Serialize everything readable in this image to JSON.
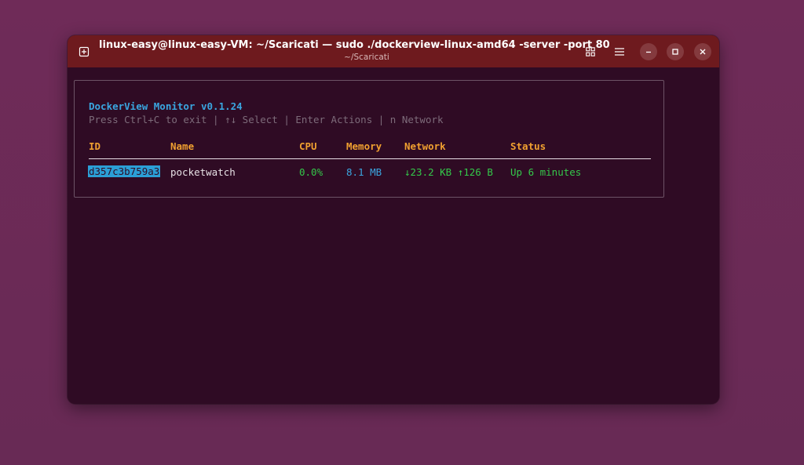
{
  "window": {
    "title": "linux-easy@linux-easy-VM: ~/Scaricati — sudo ./dockerview-linux-amd64 -server -port 80...",
    "subtitle": "~/Scaricati",
    "icons": {
      "new_tab": "new-tab-icon",
      "grid": "grid-icon",
      "menu": "hamburger-menu-icon",
      "minimize": "minimize-icon",
      "maximize": "maximize-icon",
      "close": "close-icon"
    },
    "colors": {
      "titlebar": "#6e1a1e",
      "terminal_bg": "#2f0b24",
      "desktop_bg": "#6b2a56"
    }
  },
  "app": {
    "title": "DockerView Monitor v0.1.24",
    "help": "Press Ctrl+C to exit | ↑↓ Select | Enter Actions | n Network",
    "columns": [
      "ID",
      "Name",
      "CPU",
      "Memory",
      "Network",
      "Status"
    ],
    "rows": [
      {
        "id": "d357c3b759a3",
        "name": "pocketwatch",
        "cpu": "0.0%",
        "memory": "8.1 MB",
        "network": "↓23.2 KB ↑126 B",
        "status": "Up 6 minutes",
        "selected": true
      }
    ],
    "colors": {
      "title": "#3aa6e0",
      "header": "#f0a030",
      "green": "#34c84a",
      "blue": "#3aa6e0",
      "muted": "#7d6b7a"
    }
  }
}
